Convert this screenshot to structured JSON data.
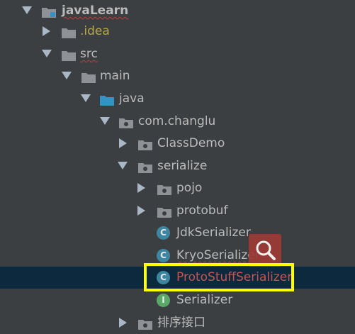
{
  "tree": {
    "project": "javaLearn",
    "idea": ".idea",
    "src": "src",
    "main": "main",
    "java": "java",
    "package": "com.changlu",
    "class_demo": "ClassDemo",
    "serialize": "serialize",
    "pojo": "pojo",
    "protobuf": "protobuf",
    "jdk": "JdkSerializer",
    "kryo": "KryoSerializer",
    "protostuff": "ProtoStuffSerializer",
    "serializer": "Serializer",
    "sort_interface": "排序接口"
  },
  "icons": {
    "class_letter": "C",
    "interface_letter": "I"
  },
  "colors": {
    "background": "#3c3f41",
    "selected_row": "#0d293e",
    "highlight": "#ffff00",
    "error_text": "#c75450"
  }
}
